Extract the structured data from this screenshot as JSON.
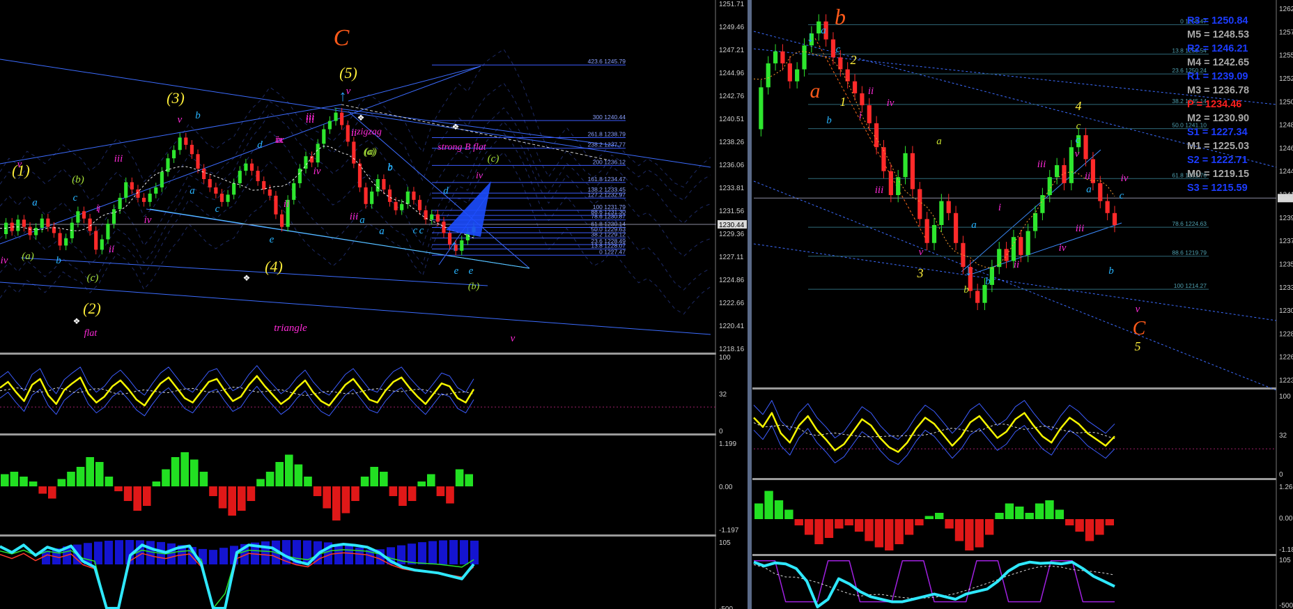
{
  "window": {
    "background": "#000000",
    "divider_color": "#7f8ca8"
  },
  "chart_data": [
    {
      "type": "line",
      "panel": "left-price",
      "description_visible": "candlestick price chart with Elliott wave labels",
      "y_axis_ticks": [
        "1251.71",
        "1249.46",
        "1247.21",
        "1244.96",
        "1242.76",
        "1240.51",
        "1238.26",
        "1236.06",
        "1233.81",
        "1231.56",
        "1229.36",
        "1227.11",
        "1224.86",
        "1222.66",
        "1220.41",
        "1218.16"
      ],
      "current_price": "1230.44",
      "ylim": [
        1218.16,
        1251.71
      ],
      "close_path": [
        1229.5,
        1230.6,
        1229.8,
        1230.9,
        1230.2,
        1229.4,
        1230.1,
        1231.0,
        1230.2,
        1229.6,
        1228.4,
        1229.1,
        1230.6,
        1231.7,
        1231.0,
        1229.8,
        1228.0,
        1229.0,
        1230.5,
        1231.9,
        1233.0,
        1234.5,
        1233.8,
        1233.0,
        1232.6,
        1233.4,
        1234.0,
        1235.5,
        1236.8,
        1237.6,
        1238.8,
        1238.1,
        1237.2,
        1235.8,
        1234.8,
        1234.0,
        1233.4,
        1232.6,
        1233.3,
        1234.4,
        1235.6,
        1236.3,
        1235.6,
        1234.6,
        1233.8,
        1233.2,
        1231.4,
        1230.2,
        1232.8,
        1234.4,
        1235.8,
        1237.0,
        1236.4,
        1238.2,
        1239.6,
        1240.4,
        1241.2,
        1240.0,
        1238.4,
        1236.3,
        1234.0,
        1232.4,
        1233.6,
        1234.8,
        1233.8,
        1232.6,
        1231.8,
        1232.4,
        1233.6,
        1232.8,
        1231.8,
        1230.9,
        1231.4,
        1230.7,
        1229.6,
        1228.5,
        1227.9,
        1228.9,
        1229.7,
        1230.2
      ],
      "fib_levels": [
        {
          "label": "423.6 1245.79",
          "value": 1245.79
        },
        {
          "label": "300 1240.44",
          "value": 1240.44
        },
        {
          "label": "261.8 1238.79",
          "value": 1238.79
        },
        {
          "label": "238.2 1237.77",
          "value": 1237.77
        },
        {
          "label": "200 1236.12",
          "value": 1236.12
        },
        {
          "label": "161.8 1234.47",
          "value": 1234.47
        },
        {
          "label": "138.2 1233.45",
          "value": 1233.45
        },
        {
          "label": "127.2 1232.97",
          "value": 1232.97
        },
        {
          "label": "100 1231.79",
          "value": 1231.79
        },
        {
          "label": "88.6 1231.30",
          "value": 1231.3
        },
        {
          "label": "78.6 1230.87",
          "value": 1230.87
        },
        {
          "label": "61.8 1230.14",
          "value": 1230.14
        },
        {
          "label": "50.0 1229.63",
          "value": 1229.63
        },
        {
          "label": "38.2 1229.12",
          "value": 1229.12
        },
        {
          "label": "23.6 1228.49",
          "value": 1228.49
        },
        {
          "label": "13.8 1228.07",
          "value": 1228.07
        },
        {
          "label": "0 1227.47",
          "value": 1227.47
        }
      ],
      "wave_labels": [
        {
          "text": "C",
          "color": "#ff5a1a"
        },
        {
          "text": "(5)",
          "color": "#ffef3a"
        },
        {
          "text": "(3)",
          "color": "#ffef3a"
        },
        {
          "text": "(1)",
          "color": "#ffef3a"
        },
        {
          "text": "(4)",
          "color": "#ffef3a"
        },
        {
          "text": "(2)",
          "color": "#ffef3a"
        },
        {
          "text": "v",
          "color": "#ff2ad8"
        },
        {
          "text": "iii",
          "color": "#ff2ad8"
        },
        {
          "text": "ix",
          "color": "#ff2ad8"
        },
        {
          "text": "zigzag",
          "color": "#ff2ad8"
        },
        {
          "text": "strong B flat",
          "color": "#ff2ad8"
        },
        {
          "text": "triangle",
          "color": "#ff2ad8"
        },
        {
          "text": "flat",
          "color": "#ff2ad8"
        },
        {
          "text": "(c)",
          "color": "#a8e33a"
        },
        {
          "text": "(b)",
          "color": "#a8e33a"
        },
        {
          "text": "(a)",
          "color": "#a8e33a"
        },
        {
          "text": "d",
          "color": "#27b4ff"
        },
        {
          "text": "b",
          "color": "#27b4ff"
        },
        {
          "text": "e",
          "color": "#27b4ff"
        },
        {
          "text": "iv",
          "color": "#ff2ad8"
        },
        {
          "text": "ii",
          "color": "#ff2ad8"
        },
        {
          "text": "a",
          "color": "#27b4ff"
        },
        {
          "text": "c",
          "color": "#27b4ff"
        },
        {
          "text": "i",
          "color": "#ff2ad8"
        }
      ]
    },
    {
      "type": "line",
      "panel": "left-oscillator-1",
      "y_axis_ticks": [
        "100",
        "32",
        "0"
      ],
      "series_color": "#f5f500",
      "values": [
        58,
        66,
        52,
        40,
        62,
        70,
        48,
        36,
        55,
        64,
        72,
        50,
        38,
        46,
        60,
        68,
        56,
        42,
        34,
        50,
        64,
        72,
        58,
        44,
        38,
        52,
        66,
        70,
        54,
        40,
        46,
        62,
        74,
        60,
        48,
        36,
        44,
        58,
        68,
        52,
        40,
        34,
        48,
        62,
        70,
        56,
        42,
        38,
        54,
        66,
        72,
        58,
        46,
        36,
        50,
        64,
        60,
        44,
        38,
        56
      ]
    },
    {
      "type": "bar",
      "panel": "left-histogram",
      "y_axis_ticks": [
        "1.199",
        "0.00",
        "-1.197"
      ],
      "values": [
        0.25,
        0.3,
        0.2,
        0.1,
        -0.15,
        -0.25,
        0.15,
        0.3,
        0.4,
        0.6,
        0.5,
        0.2,
        -0.1,
        -0.3,
        -0.5,
        -0.4,
        0.1,
        0.35,
        0.6,
        0.7,
        0.55,
        0.3,
        -0.2,
        -0.45,
        -0.6,
        -0.5,
        -0.3,
        0.15,
        0.3,
        0.5,
        0.65,
        0.45,
        0.2,
        -0.2,
        -0.45,
        -0.7,
        -0.55,
        -0.3,
        0.2,
        0.4,
        0.3,
        -0.2,
        -0.4,
        -0.3,
        0.1,
        0.25,
        -0.2,
        -0.35,
        0.35,
        0.25
      ]
    },
    {
      "type": "line",
      "panel": "left-oscillator-2",
      "y_axis_ticks": [
        "105",
        "-500"
      ],
      "series_color": "#2fe8ff",
      "values": [
        90,
        70,
        95,
        60,
        88,
        75,
        92,
        40,
        20,
        -400,
        -350,
        60,
        95,
        80,
        70,
        85,
        92,
        30,
        -300,
        -200,
        70,
        95,
        90,
        85,
        60,
        40,
        30,
        70,
        92,
        98,
        94,
        88,
        70,
        40,
        20,
        10,
        5,
        0,
        -10,
        -20,
        30
      ]
    },
    {
      "type": "line",
      "panel": "right-price",
      "y_axis_ticks": [
        "1262",
        "1257",
        "1255",
        "1252",
        "1250",
        "1248",
        "1246",
        "1244",
        "1241",
        "1239",
        "1237",
        "1235",
        "1233",
        "1230",
        "1228",
        "1226",
        "1223"
      ],
      "ylim": [
        1198,
        1262
      ],
      "close_path": [
        1241,
        1248,
        1252,
        1254,
        1252,
        1249,
        1251,
        1255,
        1257,
        1259,
        1256,
        1253,
        1251,
        1249,
        1247,
        1245,
        1242,
        1238,
        1234,
        1230,
        1233,
        1237,
        1231,
        1226,
        1222,
        1225,
        1229,
        1227,
        1222,
        1218,
        1214,
        1212,
        1215,
        1218,
        1221,
        1219,
        1223,
        1220,
        1224,
        1227,
        1230,
        1233,
        1235,
        1232,
        1238,
        1240,
        1236,
        1232,
        1229,
        1227,
        1225
      ],
      "fib_levels": [
        {
          "label": "0 1258.47",
          "value": 1258.47
        },
        {
          "label": "13.8 1253.54",
          "value": 1253.54
        },
        {
          "label": "23.6 1250.24",
          "value": 1250.24
        },
        {
          "label": "38.2 1245.14",
          "value": 1245.14
        },
        {
          "label": "50.0 1241.10",
          "value": 1241.1
        },
        {
          "label": "61.8 1232.76",
          "value": 1232.76
        },
        {
          "label": "78.6 1224.63",
          "value": 1224.63
        },
        {
          "label": "88.6 1219.79",
          "value": 1219.79
        },
        {
          "label": "100 1214.27",
          "value": 1214.27
        }
      ],
      "pivot_levels": [
        {
          "label": "R3 = 1250.84",
          "color": "#1c3cff"
        },
        {
          "label": "M5 = 1248.53",
          "color": "#a8a8a8"
        },
        {
          "label": "R2 = 1246.21",
          "color": "#1c3cff"
        },
        {
          "label": "M4 = 1242.65",
          "color": "#a8a8a8"
        },
        {
          "label": "R1 = 1239.09",
          "color": "#1c3cff"
        },
        {
          "label": "M3 = 1236.78",
          "color": "#a8a8a8"
        },
        {
          "label": "P = 1234.46",
          "color": "#ff2020"
        },
        {
          "label": "M2 = 1230.90",
          "color": "#a8a8a8"
        },
        {
          "label": "S1 = 1227.34",
          "color": "#1c3cff"
        },
        {
          "label": "M1 = 1225.03",
          "color": "#a8a8a8"
        },
        {
          "label": "S2 = 1222.71",
          "color": "#1c3cff"
        },
        {
          "label": "M0 = 1219.15",
          "color": "#a8a8a8"
        },
        {
          "label": "S3 = 1215.59",
          "color": "#1c3cff"
        }
      ],
      "wave_labels": [
        {
          "text": "b",
          "color": "#ff5a1a"
        },
        {
          "text": "a",
          "color": "#ff5a1a"
        },
        {
          "text": "C",
          "color": "#ff5a1a"
        },
        {
          "text": "4",
          "color": "#ffef3a"
        },
        {
          "text": "3",
          "color": "#ffef3a"
        },
        {
          "text": "5",
          "color": "#ffef3a"
        },
        {
          "text": "2",
          "color": "#ffef3a"
        },
        {
          "text": "1",
          "color": "#ffef3a"
        }
      ]
    },
    {
      "type": "line",
      "panel": "right-oscillator-1",
      "y_axis_ticks": [
        "100",
        "32",
        "0"
      ],
      "series_color": "#f5f500",
      "values": [
        72,
        60,
        78,
        52,
        40,
        62,
        74,
        56,
        44,
        30,
        38,
        54,
        70,
        62,
        46,
        34,
        28,
        40,
        58,
        72,
        64,
        50,
        36,
        48,
        66,
        74,
        60,
        46,
        54,
        70,
        78,
        62,
        48,
        40,
        58,
        72,
        64,
        52,
        44,
        36,
        48
      ]
    },
    {
      "type": "bar",
      "panel": "right-histogram",
      "y_axis_ticks": [
        "1.26",
        "0.00",
        "-1.18"
      ],
      "values": [
        0.5,
        0.9,
        0.6,
        0.3,
        -0.2,
        -0.5,
        -0.8,
        -0.6,
        -0.3,
        -0.2,
        -0.4,
        -0.7,
        -0.9,
        -1.0,
        -0.8,
        -0.5,
        -0.2,
        0.1,
        0.2,
        -0.3,
        -0.7,
        -1.0,
        -0.9,
        -0.5,
        0.2,
        0.5,
        0.4,
        0.2,
        0.5,
        0.6,
        0.3,
        -0.2,
        -0.4,
        -0.7,
        -0.5,
        -0.2
      ]
    },
    {
      "type": "line",
      "panel": "right-oscillator-2",
      "y_axis_ticks": [
        "105",
        "-500"
      ],
      "series_color": "#2fe8ff",
      "values": [
        95,
        80,
        92,
        88,
        70,
        20,
        -100,
        -50,
        30,
        10,
        -20,
        -40,
        -50,
        -60,
        -60,
        -50,
        -40,
        -30,
        -40,
        -50,
        -30,
        -20,
        -10,
        20,
        60,
        85,
        95,
        90,
        92,
        88,
        95,
        70,
        40,
        20,
        0
      ]
    }
  ]
}
